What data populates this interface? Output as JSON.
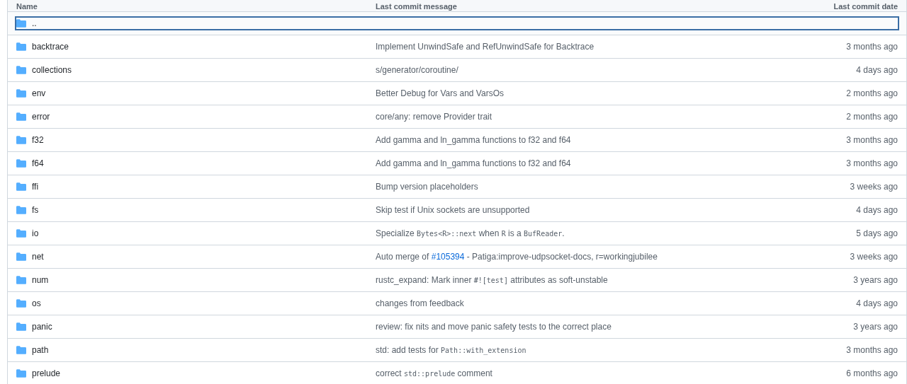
{
  "table": {
    "columns": [
      "Name",
      "Last commit message",
      "Last commit date"
    ],
    "rows": [
      {
        "kind": "parent",
        "name": "..",
        "selected": true,
        "message": [],
        "date": ""
      },
      {
        "kind": "folder",
        "name": "backtrace",
        "selected": false,
        "message": [
          {
            "kind": "text",
            "text": "Implement UnwindSafe and RefUnwindSafe for Backtrace"
          }
        ],
        "date": "3 months ago"
      },
      {
        "kind": "folder",
        "name": "collections",
        "selected": false,
        "message": [
          {
            "kind": "text",
            "text": "s/generator/coroutine/"
          }
        ],
        "date": "4 days ago"
      },
      {
        "kind": "folder",
        "name": "env",
        "selected": false,
        "message": [
          {
            "kind": "text",
            "text": "Better Debug for Vars and VarsOs"
          }
        ],
        "date": "2 months ago"
      },
      {
        "kind": "folder",
        "name": "error",
        "selected": false,
        "message": [
          {
            "kind": "text",
            "text": "core/any: remove Provider trait"
          }
        ],
        "date": "2 months ago"
      },
      {
        "kind": "folder",
        "name": "f32",
        "selected": false,
        "message": [
          {
            "kind": "text",
            "text": "Add gamma and ln_gamma functions to f32 and f64"
          }
        ],
        "date": "3 months ago"
      },
      {
        "kind": "folder",
        "name": "f64",
        "selected": false,
        "message": [
          {
            "kind": "text",
            "text": "Add gamma and ln_gamma functions to f32 and f64"
          }
        ],
        "date": "3 months ago"
      },
      {
        "kind": "folder",
        "name": "ffi",
        "selected": false,
        "message": [
          {
            "kind": "text",
            "text": "Bump version placeholders"
          }
        ],
        "date": "3 weeks ago"
      },
      {
        "kind": "folder",
        "name": "fs",
        "selected": false,
        "message": [
          {
            "kind": "text",
            "text": "Skip test if Unix sockets are unsupported"
          }
        ],
        "date": "4 days ago"
      },
      {
        "kind": "folder",
        "name": "io",
        "selected": false,
        "message": [
          {
            "kind": "text",
            "text": "Specialize "
          },
          {
            "kind": "code",
            "text": "Bytes<R>::next"
          },
          {
            "kind": "text",
            "text": " when "
          },
          {
            "kind": "code",
            "text": "R"
          },
          {
            "kind": "text",
            "text": " is a "
          },
          {
            "kind": "code",
            "text": "BufReader"
          },
          {
            "kind": "text",
            "text": "."
          }
        ],
        "date": "5 days ago"
      },
      {
        "kind": "folder",
        "name": "net",
        "selected": false,
        "message": [
          {
            "kind": "text",
            "text": "Auto merge of "
          },
          {
            "kind": "link",
            "text": "#105394"
          },
          {
            "kind": "text",
            "text": " - Patiga:improve-udpsocket-docs, r=workingjubilee"
          }
        ],
        "date": "3 weeks ago"
      },
      {
        "kind": "folder",
        "name": "num",
        "selected": false,
        "message": [
          {
            "kind": "text",
            "text": "rustc_expand: Mark inner "
          },
          {
            "kind": "code",
            "text": "#![test]"
          },
          {
            "kind": "text",
            "text": " attributes as soft-unstable"
          }
        ],
        "date": "3 years ago"
      },
      {
        "kind": "folder",
        "name": "os",
        "selected": false,
        "message": [
          {
            "kind": "text",
            "text": "changes from feedback"
          }
        ],
        "date": "4 days ago"
      },
      {
        "kind": "folder",
        "name": "panic",
        "selected": false,
        "message": [
          {
            "kind": "text",
            "text": "review: fix nits and move panic safety tests to the correct place"
          }
        ],
        "date": "3 years ago"
      },
      {
        "kind": "folder",
        "name": "path",
        "selected": false,
        "message": [
          {
            "kind": "text",
            "text": "std: add tests for "
          },
          {
            "kind": "code",
            "text": "Path::with_extension"
          }
        ],
        "date": "3 months ago"
      },
      {
        "kind": "folder",
        "name": "prelude",
        "selected": false,
        "message": [
          {
            "kind": "text",
            "text": "correct "
          },
          {
            "kind": "code",
            "text": "std::prelude"
          },
          {
            "kind": "text",
            "text": " comment"
          }
        ],
        "date": "6 months ago"
      }
    ]
  }
}
